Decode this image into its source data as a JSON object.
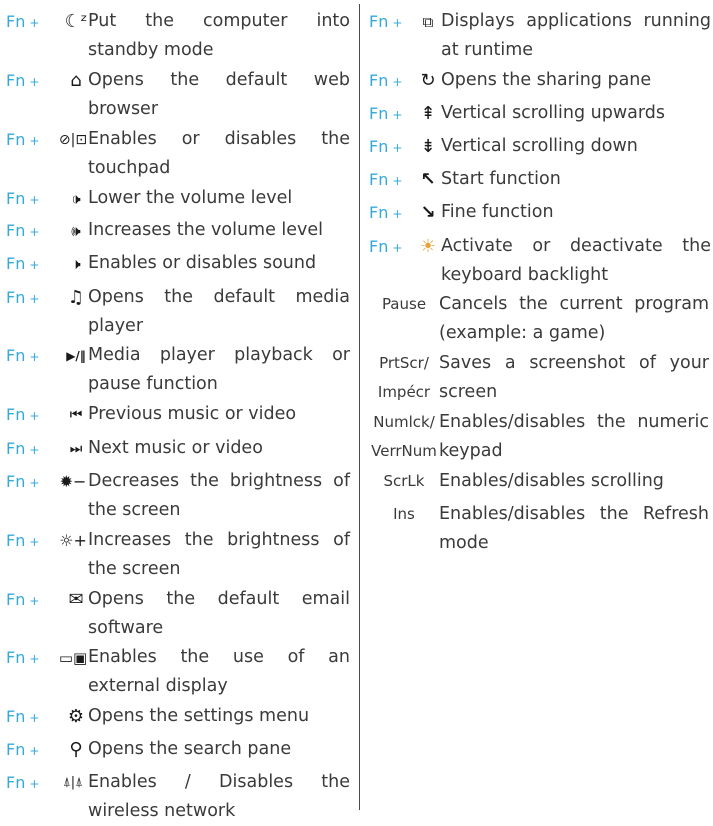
{
  "colors": {
    "key": "#35a9dc",
    "text": "#3a3a3a",
    "divider": "#4a4a4a"
  },
  "key_label": "Fn",
  "plus": "+",
  "left_column": [
    {
      "icon": "moon-standby-icon",
      "glyph": "☾ᶻ",
      "desc": "Put the computer into standby mode"
    },
    {
      "icon": "home-icon",
      "glyph": "⌂",
      "desc": "Opens the default web browser"
    },
    {
      "icon": "touchpad-toggle-icon",
      "glyph": "⊘|⊡",
      "desc": "Enables or disables the touchpad"
    },
    {
      "icon": "volume-down-icon",
      "glyph": "🕩",
      "desc": "Lower the volume level"
    },
    {
      "icon": "volume-up-icon",
      "glyph": "🕪",
      "desc": "Increases the volume level"
    },
    {
      "icon": "mute-icon",
      "glyph": "🕨",
      "desc": "Enables or disables sound"
    },
    {
      "icon": "music-note-icon",
      "glyph": "♫",
      "desc": "Opens the default media player"
    },
    {
      "icon": "play-pause-icon",
      "glyph": "▶/‖",
      "desc": "Media player playback or pause function"
    },
    {
      "icon": "previous-track-icon",
      "glyph": "⏮",
      "desc": "Previous music or video"
    },
    {
      "icon": "next-track-icon",
      "glyph": "⏭",
      "desc": "Next music or video"
    },
    {
      "icon": "brightness-down-icon",
      "glyph": "✹−",
      "desc": "Decreases the brightness of the screen"
    },
    {
      "icon": "brightness-up-icon",
      "glyph": "☼+",
      "desc": "Increases the brightness of the screen"
    },
    {
      "icon": "envelope-icon",
      "glyph": "✉",
      "desc": "Opens the default email software"
    },
    {
      "icon": "external-display-icon",
      "glyph": "▭▣",
      "desc": "Enables the use of an external display"
    },
    {
      "icon": "gear-icon",
      "glyph": "⚙",
      "desc": "Opens the settings menu"
    },
    {
      "icon": "search-icon",
      "glyph": "⚲",
      "desc": "Opens the search pane"
    },
    {
      "icon": "wireless-icon",
      "glyph": "⍋|⍋",
      "desc": "Enables / Disables the wireless network"
    }
  ],
  "right_column": [
    {
      "key": "Fn",
      "icon": "running-apps-icon",
      "glyph": "⧉",
      "desc": "Displays applications running at runtime"
    },
    {
      "key": "Fn",
      "icon": "share-icon",
      "glyph": "↻",
      "desc": "Opens the sharing pane"
    },
    {
      "key": "Fn",
      "icon": "scroll-up-icon",
      "glyph": "⇞",
      "desc": "Vertical scrolling upwards"
    },
    {
      "key": "Fn",
      "icon": "scroll-down-icon",
      "glyph": "⇟",
      "desc": "Vertical scrolling down"
    },
    {
      "key": "Fn",
      "icon": "start-arrow-icon",
      "glyph": "↖",
      "desc": "Start function"
    },
    {
      "key": "Fn",
      "icon": "end-arrow-icon",
      "glyph": "↘",
      "desc": "Fine function"
    },
    {
      "key": "Fn",
      "icon": "keyboard-backlight-icon",
      "glyph": "☀",
      "desc": "Activate or deactivate the keyboard backlight"
    },
    {
      "key_lines": [
        "Pause"
      ],
      "desc": "Cancels the current program (example: a game)"
    },
    {
      "key_lines": [
        "PrtScr/",
        "Impécr"
      ],
      "desc": "Saves a screenshot of your screen"
    },
    {
      "key_lines": [
        "Numlck/",
        "VerrNum"
      ],
      "desc": "Enables/disables the numeric keypad"
    },
    {
      "key_lines": [
        "ScrLk"
      ],
      "desc": "Enables/disables scrolling"
    },
    {
      "key_lines": [
        "Ins"
      ],
      "desc": "Enables/disables the Refresh mode"
    }
  ]
}
